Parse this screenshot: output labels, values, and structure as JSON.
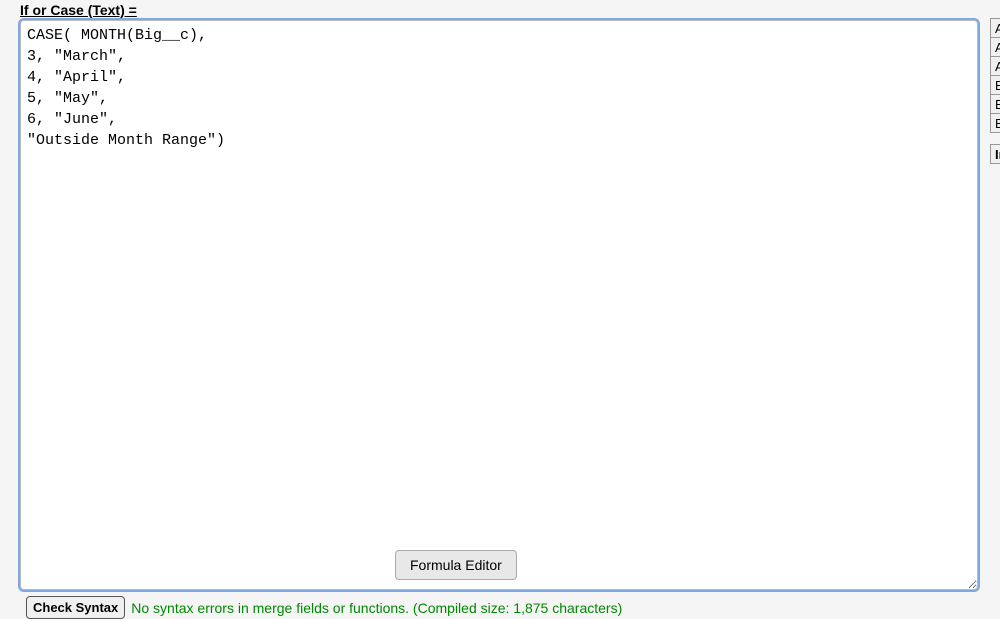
{
  "field_label": "If or Case (Text) =",
  "formula_text": "CASE( MONTH(Big__c),\n3, \"March\",\n4, \"April\",\n5, \"May\",\n6, \"June\",\n\"Outside Month Range\")",
  "side_functions": [
    "AB",
    "AD",
    "AN",
    "BE",
    "BL",
    "BR"
  ],
  "insert_label": "In",
  "formula_editor_button": "Formula Editor",
  "check_syntax_button": "Check Syntax",
  "syntax_status": "No syntax errors in merge fields or functions. (Compiled size: 1,875 characters)"
}
